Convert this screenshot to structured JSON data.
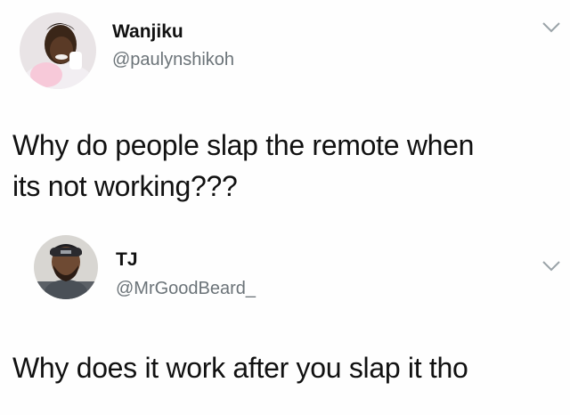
{
  "tweets": [
    {
      "display_name": "Wanjiku",
      "handle": "@paulynshikoh",
      "text_line_1": "Why do people slap the remote when",
      "text_line_2": "its not working???",
      "avatar_icon": "profile-photo-icon",
      "menu_icon": "chevron-down-icon"
    },
    {
      "display_name": "TJ",
      "handle": "@MrGoodBeard_",
      "text": "Why does it work after you slap it tho",
      "avatar_icon": "profile-photo-icon",
      "menu_icon": "chevron-down-icon"
    }
  ],
  "colors": {
    "text": "#111111",
    "handle": "#6b7378",
    "caret": "#9aa3a8",
    "background": "#fefefe"
  }
}
